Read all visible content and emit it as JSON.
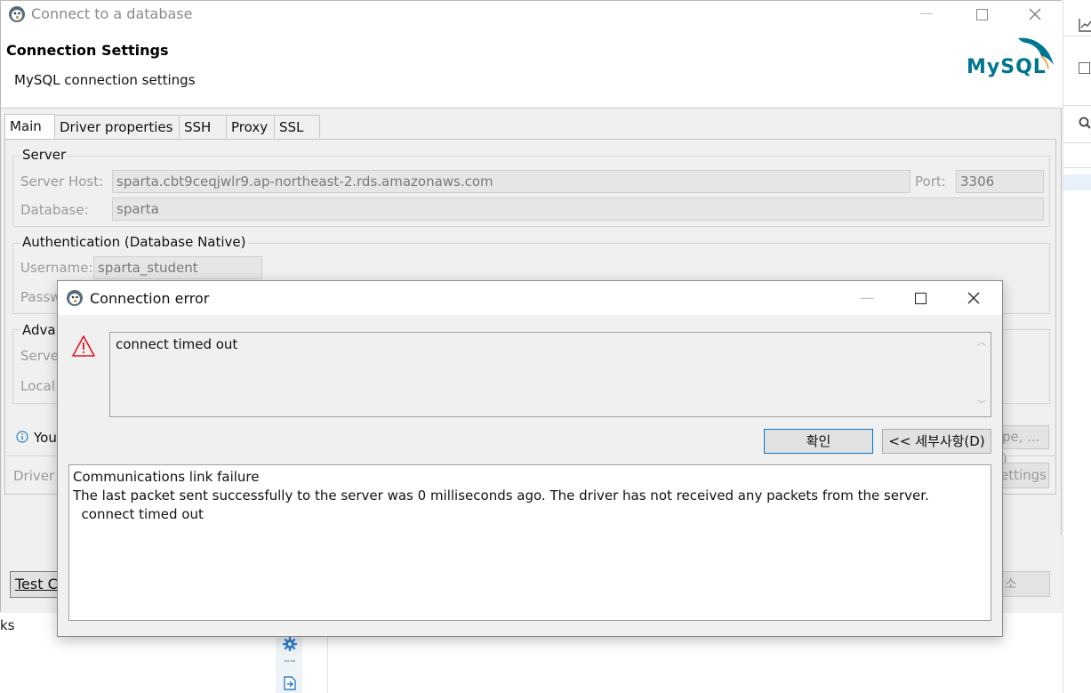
{
  "main_window": {
    "title": "Connect to a database",
    "header_title": "Connection Settings",
    "header_subtitle": "MySQL connection settings",
    "logo_text": "MySQL",
    "tabs": [
      {
        "label": "Main"
      },
      {
        "label": "Driver properties"
      },
      {
        "label": "SSH"
      },
      {
        "label": "Proxy"
      },
      {
        "label": "SSL"
      }
    ],
    "server_group": {
      "legend": "Server",
      "host_label": "Server Host:",
      "host_value": "sparta.cbt9ceqjwlr9.ap-northeast-2.rds.amazonaws.com",
      "port_label": "Port:",
      "port_value": "3306",
      "database_label": "Database:",
      "database_value": "sparta"
    },
    "auth_group": {
      "legend": "Authentication (Database Native)",
      "username_label": "Username:",
      "username_value": "sparta_student",
      "password_label_partial": "Passw"
    },
    "advanced_group": {
      "legend_partial": "Advan",
      "server_label_partial": "Server",
      "local_label_partial": "Local"
    },
    "info_text_partial": "You",
    "driver_label_partial": "Driver",
    "right_button_partial_1": "pe, ... )",
    "right_button_partial_2": "ettings",
    "test_button_partial": "Test C",
    "cancel_button_partial": "소"
  },
  "error_dialog": {
    "title": "Connection error",
    "message": "connect timed out",
    "ok_label": "확인",
    "details_label": "<< 세부사항(D)",
    "details_lines": [
      "Communications link failure",
      "The last packet sent successfully to the server was 0 milliseconds ago. The driver has not received any packets from the server.",
      "  connect timed out"
    ]
  },
  "background": {
    "partial_text": "ks"
  },
  "colors": {
    "accent": "#0078d7",
    "warning": "#e81123",
    "mysql_blue": "#00758f",
    "mysql_orange": "#f29111"
  }
}
